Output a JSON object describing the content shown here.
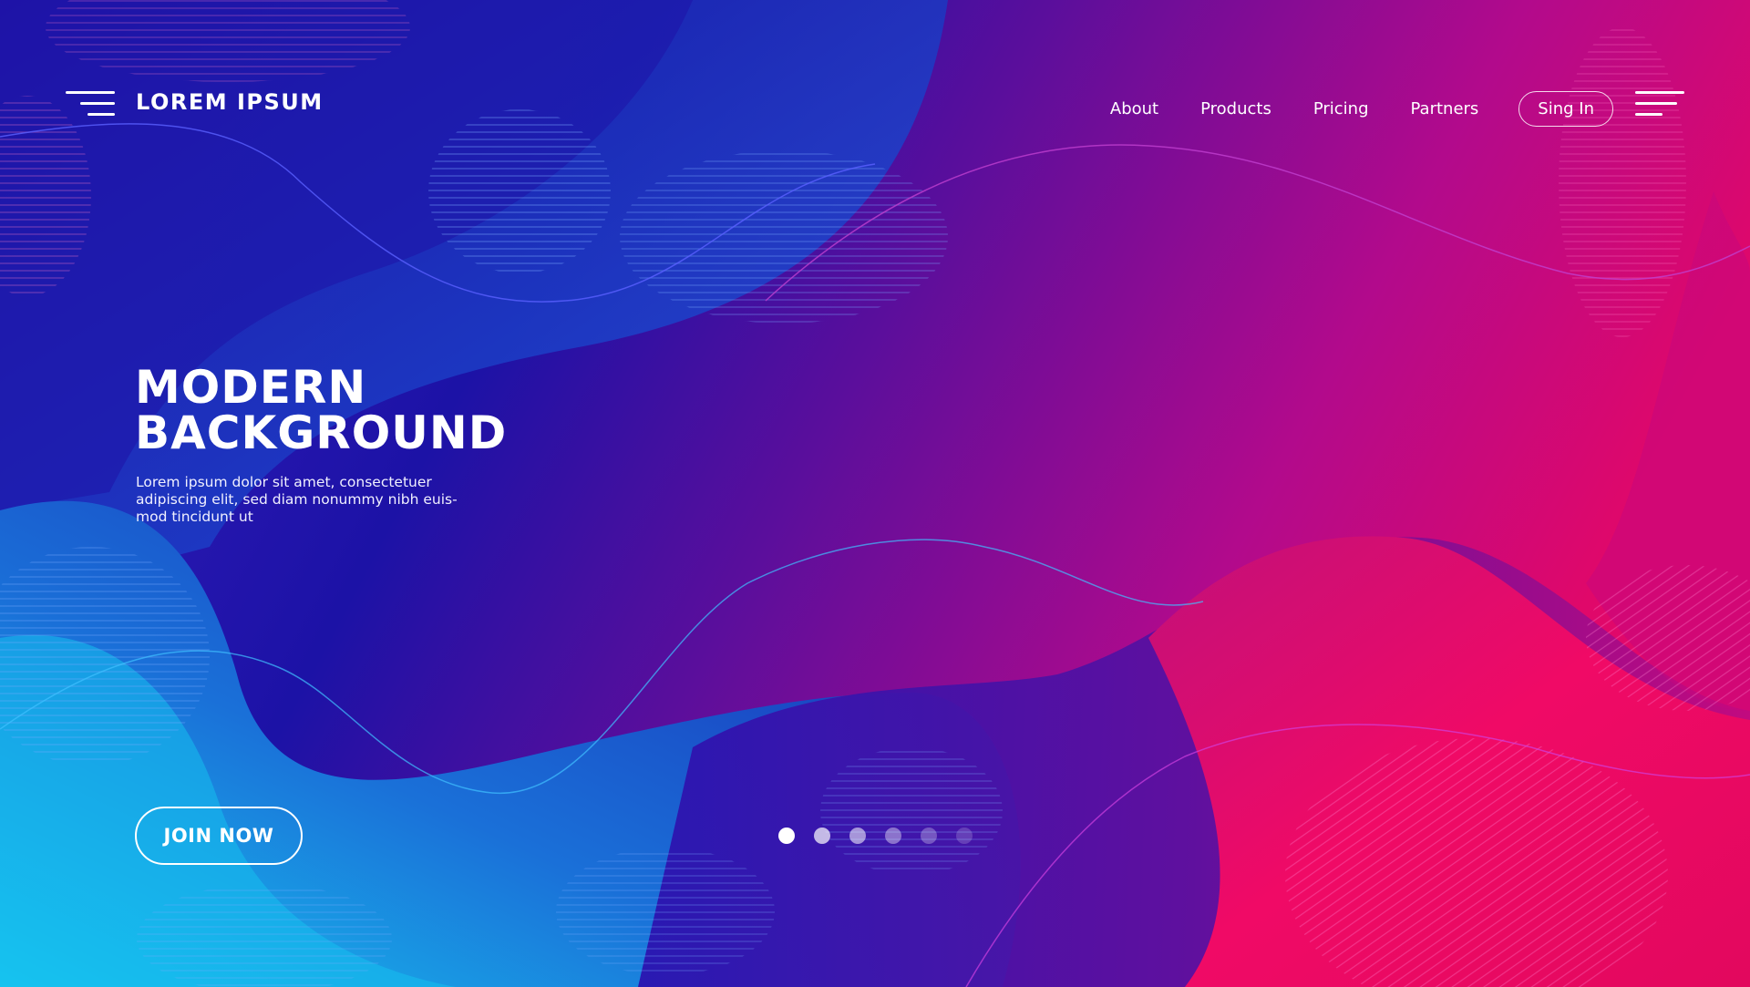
{
  "brand": {
    "name": "LOREM IPSUM"
  },
  "nav": {
    "items": [
      {
        "label": "About"
      },
      {
        "label": "Products"
      },
      {
        "label": "Pricing"
      },
      {
        "label": "Partners"
      }
    ],
    "signin_label": "Sing In"
  },
  "hero": {
    "title_line1": "MODERN",
    "title_line2": "BACKGROUND",
    "description": "Lorem ipsum dolor sit amet, consectetuer adipiscing elit, sed diam nonummy nibh euis-mod tincidunt ut",
    "cta_label": "JOIN NOW"
  },
  "pagination": {
    "count": 6,
    "active_index": 0
  },
  "colors": {
    "blue_deep": "#1a10a8",
    "blue_light": "#1aa0e8",
    "magenta": "#b0088f",
    "pink": "#e8055e"
  }
}
